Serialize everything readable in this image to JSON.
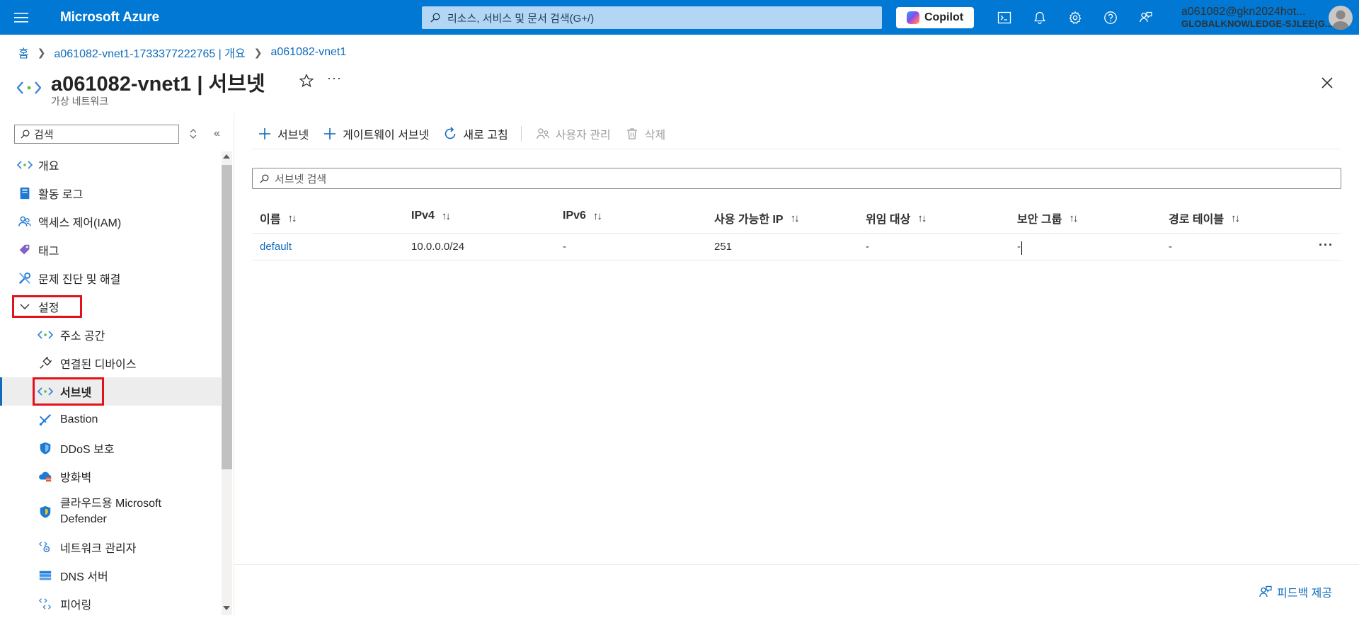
{
  "topbar": {
    "brand": "Microsoft Azure",
    "search_placeholder": "리소스, 서비스 및 문서 검색(G+/)",
    "copilot_label": "Copilot",
    "account_email": "a061082@gkn2024hot...",
    "account_tenant": "GLOBALKNOWLEDGE-SJLEE(G...",
    "bg_color": "#0078d4"
  },
  "breadcrumb": [
    "홈",
    "a061082-vnet1-1733377222765 | 개요",
    "a061082-vnet1"
  ],
  "header": {
    "title": "a061082-vnet1 | 서브넷",
    "subtitle": "가상 네트워크",
    "more": "···"
  },
  "sidebar": {
    "search_placeholder": "검색",
    "collapse": "«",
    "items": [
      {
        "label": "개요",
        "icon": "vnet-icon"
      },
      {
        "label": "활동 로그",
        "icon": "activity-log-icon"
      },
      {
        "label": "액세스 제어(IAM)",
        "icon": "iam-icon"
      },
      {
        "label": "태그",
        "icon": "tag-icon"
      },
      {
        "label": "문제 진단 및 해결",
        "icon": "wrench-icon"
      },
      {
        "label": "설정",
        "icon": "chevron-down-icon"
      },
      {
        "label": "주소 공간",
        "icon": "vnet-icon"
      },
      {
        "label": "연결된 디바이스",
        "icon": "plug-icon"
      },
      {
        "label": "서브넷",
        "icon": "vnet-icon"
      },
      {
        "label": "Bastion",
        "icon": "bastion-icon"
      },
      {
        "label": "DDoS 보호",
        "icon": "shield-icon"
      },
      {
        "label": "방화벽",
        "icon": "firewall-icon"
      },
      {
        "label": "클라우드용 Microsoft Defender",
        "icon": "defender-icon"
      },
      {
        "label": "네트워크 관리자",
        "icon": "network-manager-icon"
      },
      {
        "label": "DNS 서버",
        "icon": "dns-icon"
      },
      {
        "label": "피어링",
        "icon": "peering-icon"
      }
    ]
  },
  "toolbar": {
    "add_subnet": "서브넷",
    "add_gateway_subnet": "게이트웨이 서브넷",
    "refresh": "새로 고침",
    "manage_users": "사용자 관리",
    "delete": "삭제"
  },
  "filter": {
    "placeholder": "서브넷 검색"
  },
  "table": {
    "sort_glyph": "↑↓",
    "columns": [
      "이름",
      "IPv4",
      "IPv6",
      "사용 가능한 IP",
      "위임 대상",
      "보안 그룹",
      "경로 테이블"
    ],
    "rows": [
      [
        "default",
        "10.0.0.0/24",
        "-",
        "251",
        "-",
        "-",
        "-"
      ]
    ],
    "row_more": "···"
  },
  "footer": {
    "feedback": "피드백 제공"
  }
}
